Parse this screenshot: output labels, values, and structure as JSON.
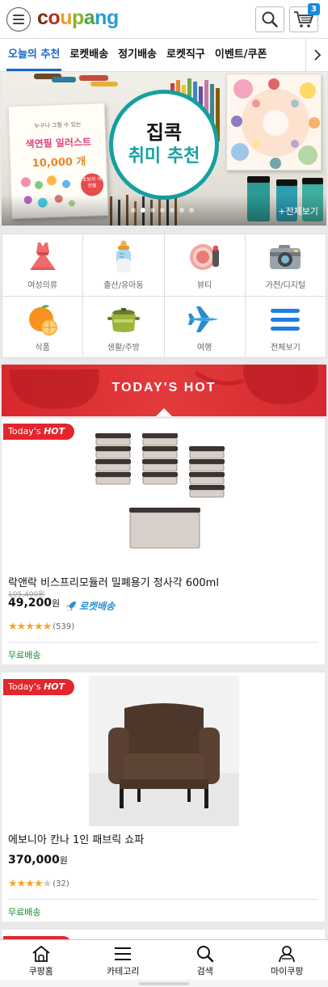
{
  "header": {
    "logo_letters": [
      {
        "ch": "c",
        "color": "#7b2b15"
      },
      {
        "ch": "o",
        "color": "#b5322a"
      },
      {
        "ch": "u",
        "color": "#e6a123"
      },
      {
        "ch": "p",
        "color": "#8ab42a"
      },
      {
        "ch": "a",
        "color": "#4fa244"
      },
      {
        "ch": "n",
        "color": "#2a9cd4"
      },
      {
        "ch": "g",
        "color": "#2a9cd4"
      }
    ],
    "cart_count": "3",
    "icons": {
      "menu": "hamburger-icon",
      "search": "search-icon",
      "cart": "cart-icon"
    }
  },
  "tabs": [
    {
      "label": "오늘의 추천",
      "active": true
    },
    {
      "label": "로켓배송",
      "active": false
    },
    {
      "label": "정기배송",
      "active": false
    },
    {
      "label": "로켓직구",
      "active": false
    },
    {
      "label": "이벤트/쿠폰",
      "active": false
    }
  ],
  "banner": {
    "title_line1": "집콕",
    "title_line2": "취미 추천",
    "view_all": "+전체보기",
    "book": {
      "subtitle": "누구나 그릴 수 있는",
      "title": "색연필 일러스트",
      "count": "10,000 개",
      "badge": "초보자 색연필"
    },
    "slide_count": 7,
    "active_slide": 1
  },
  "categories": [
    {
      "label": "여성의류",
      "icon": "dress-icon"
    },
    {
      "label": "출산/유아동",
      "icon": "baby-bottle-icon"
    },
    {
      "label": "뷰티",
      "icon": "compact-mirror-icon"
    },
    {
      "label": "가전/디지털",
      "icon": "camera-icon"
    },
    {
      "label": "식품",
      "icon": "orange-icon"
    },
    {
      "label": "생활/주방",
      "icon": "pot-icon"
    },
    {
      "label": "여행",
      "icon": "airplane-icon"
    },
    {
      "label": "전체보기",
      "icon": "list-icon"
    }
  ],
  "hot_section": {
    "title": "TODAY'S HOT"
  },
  "products": [
    {
      "tag_prefix": "Today's",
      "tag_emph": "HOT",
      "name": "락앤락 비스프리모듈러 밀폐용기 정사각 600ml",
      "original_price": "105,400원",
      "price": "49,200",
      "price_unit": "원",
      "rocket": "로켓배송",
      "rating": 4.5,
      "stars_text": "★★★★★",
      "review_count": "(539)",
      "shipping": "무료배송"
    },
    {
      "tag_prefix": "Today's",
      "tag_emph": "HOT",
      "name": "에보니아 칸나 1인 패브릭 쇼파",
      "price": "370,000",
      "price_unit": "원",
      "rating": 4,
      "stars_on": "★★★★",
      "stars_off": "★",
      "review_count": "(32)",
      "shipping": "무료배송"
    }
  ],
  "bottom_nav": [
    {
      "label": "쿠팡홈",
      "icon": "home-icon"
    },
    {
      "label": "카테고리",
      "icon": "category-icon"
    },
    {
      "label": "검색",
      "icon": "search-icon"
    },
    {
      "label": "마이쿠팡",
      "icon": "user-icon"
    }
  ]
}
